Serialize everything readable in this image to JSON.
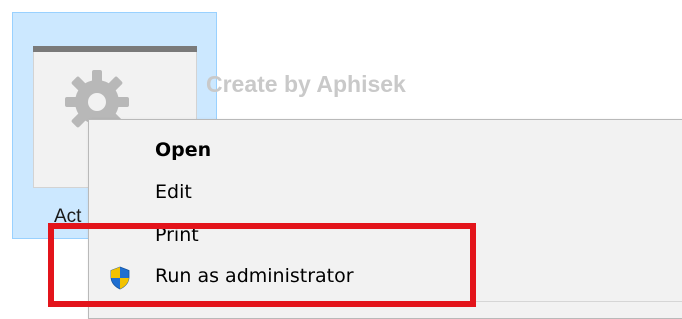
{
  "file": {
    "label": "Act",
    "icon": "gear-icon"
  },
  "watermark": "Create by Aphisek",
  "context_menu": {
    "items": [
      {
        "label": "Open",
        "default": true
      },
      {
        "label": "Edit"
      },
      {
        "label": "Print"
      },
      {
        "label": "Run as administrator",
        "icon": "shield-icon"
      }
    ]
  },
  "colors": {
    "selection_fill": "#cce8ff",
    "selection_border": "#99d1ff",
    "menu_bg": "#f2f2f2",
    "highlight": "#e3141b",
    "shield_blue": "#1f6fd1",
    "shield_yellow": "#f2c200"
  }
}
